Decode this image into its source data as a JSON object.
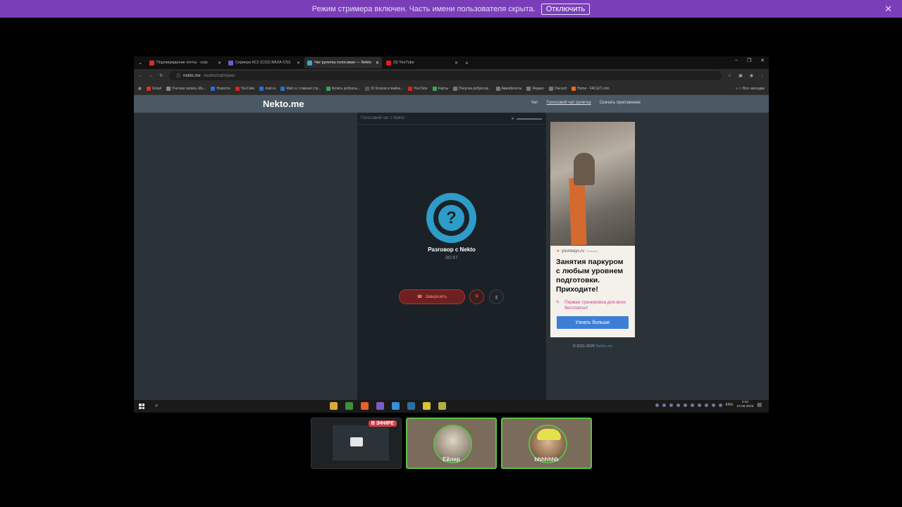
{
  "streamer_banner": {
    "message": "Режим стримера включен. Часть имени пользователя скрыта.",
    "disable_label": "Отключить"
  },
  "browser": {
    "tabs": [
      {
        "title": "Подтверждение почты - unjo",
        "color": "#d93025"
      },
      {
        "title": "Сервера КС2 (CS2) BAZA-CS2.",
        "color": "#6a5acd"
      },
      {
        "title": "Чат рулетка голосовая — Nekto",
        "color": "#3aa5c9",
        "active": true
      },
      {
        "title": "(9) YouTube",
        "color": "#e02020"
      }
    ],
    "new_tab": "+",
    "url_host": "nekto.me",
    "url_path": "/audiochat#/peer",
    "bookmarks": [
      {
        "label": "Gmail",
        "color": "#d93025"
      },
      {
        "label": "Учетная запись Ma...",
        "color": "#888"
      },
      {
        "label": "Новости",
        "color": "#2a6fd6"
      },
      {
        "label": "YouTube",
        "color": "#e02020"
      },
      {
        "label": "mail.ru",
        "color": "#2a6fd6"
      },
      {
        "label": "Mail.ru: главная стр...",
        "color": "#2a6fd6"
      },
      {
        "label": "Купить робуксы...",
        "color": "#3aa55a"
      },
      {
        "label": "ID блоков в майнк...",
        "color": "#555"
      },
      {
        "label": "YouTube",
        "color": "#e02020"
      },
      {
        "label": "Карты",
        "color": "#3aa55a"
      },
      {
        "label": "Покупка робуксов...",
        "color": "#777"
      },
      {
        "label": "Авиабилеты",
        "color": "#777"
      },
      {
        "label": "Яндекс",
        "color": "#777"
      },
      {
        "label": "Discord",
        "color": "#777"
      },
      {
        "label": "Home - FACEIT.com",
        "color": "#e86a1a"
      }
    ],
    "all_bookmarks": "Все закладки"
  },
  "site": {
    "logo": "Nekto.me",
    "nav": [
      "Чат",
      "Голосовой чат рулетка",
      "Скачать приложение"
    ],
    "chat_header": "Голосовой чат с Nekto",
    "conversation_title": "Разговор с Nekto",
    "timer": "00:47",
    "end_button": "Завершить",
    "copyright_prefix": "© 2011-2026",
    "copyright_link": "Nekto.me"
  },
  "ad": {
    "source": "yourways.ru",
    "source_sub": "Реклама",
    "headline": "Занятия паркуром с любым уровнем подготовки. Приходите!",
    "promo": "Первая тренировка для всех бесплатно!",
    "cta": "Узнать больше"
  },
  "taskbar": {
    "lang": "ENG",
    "time": "2:04",
    "date": "23.06.2026",
    "app_colors": [
      "#d9a935",
      "#3c8f3c",
      "#e8602a",
      "#7a5cc7",
      "#3a8fd8",
      "#2a6f9f",
      "#d9c23a",
      "#b0b040"
    ]
  },
  "participants": {
    "live_badge": "В ЭФИРЕ",
    "user1": "Ейляр",
    "user2": "hhhhhhh"
  }
}
